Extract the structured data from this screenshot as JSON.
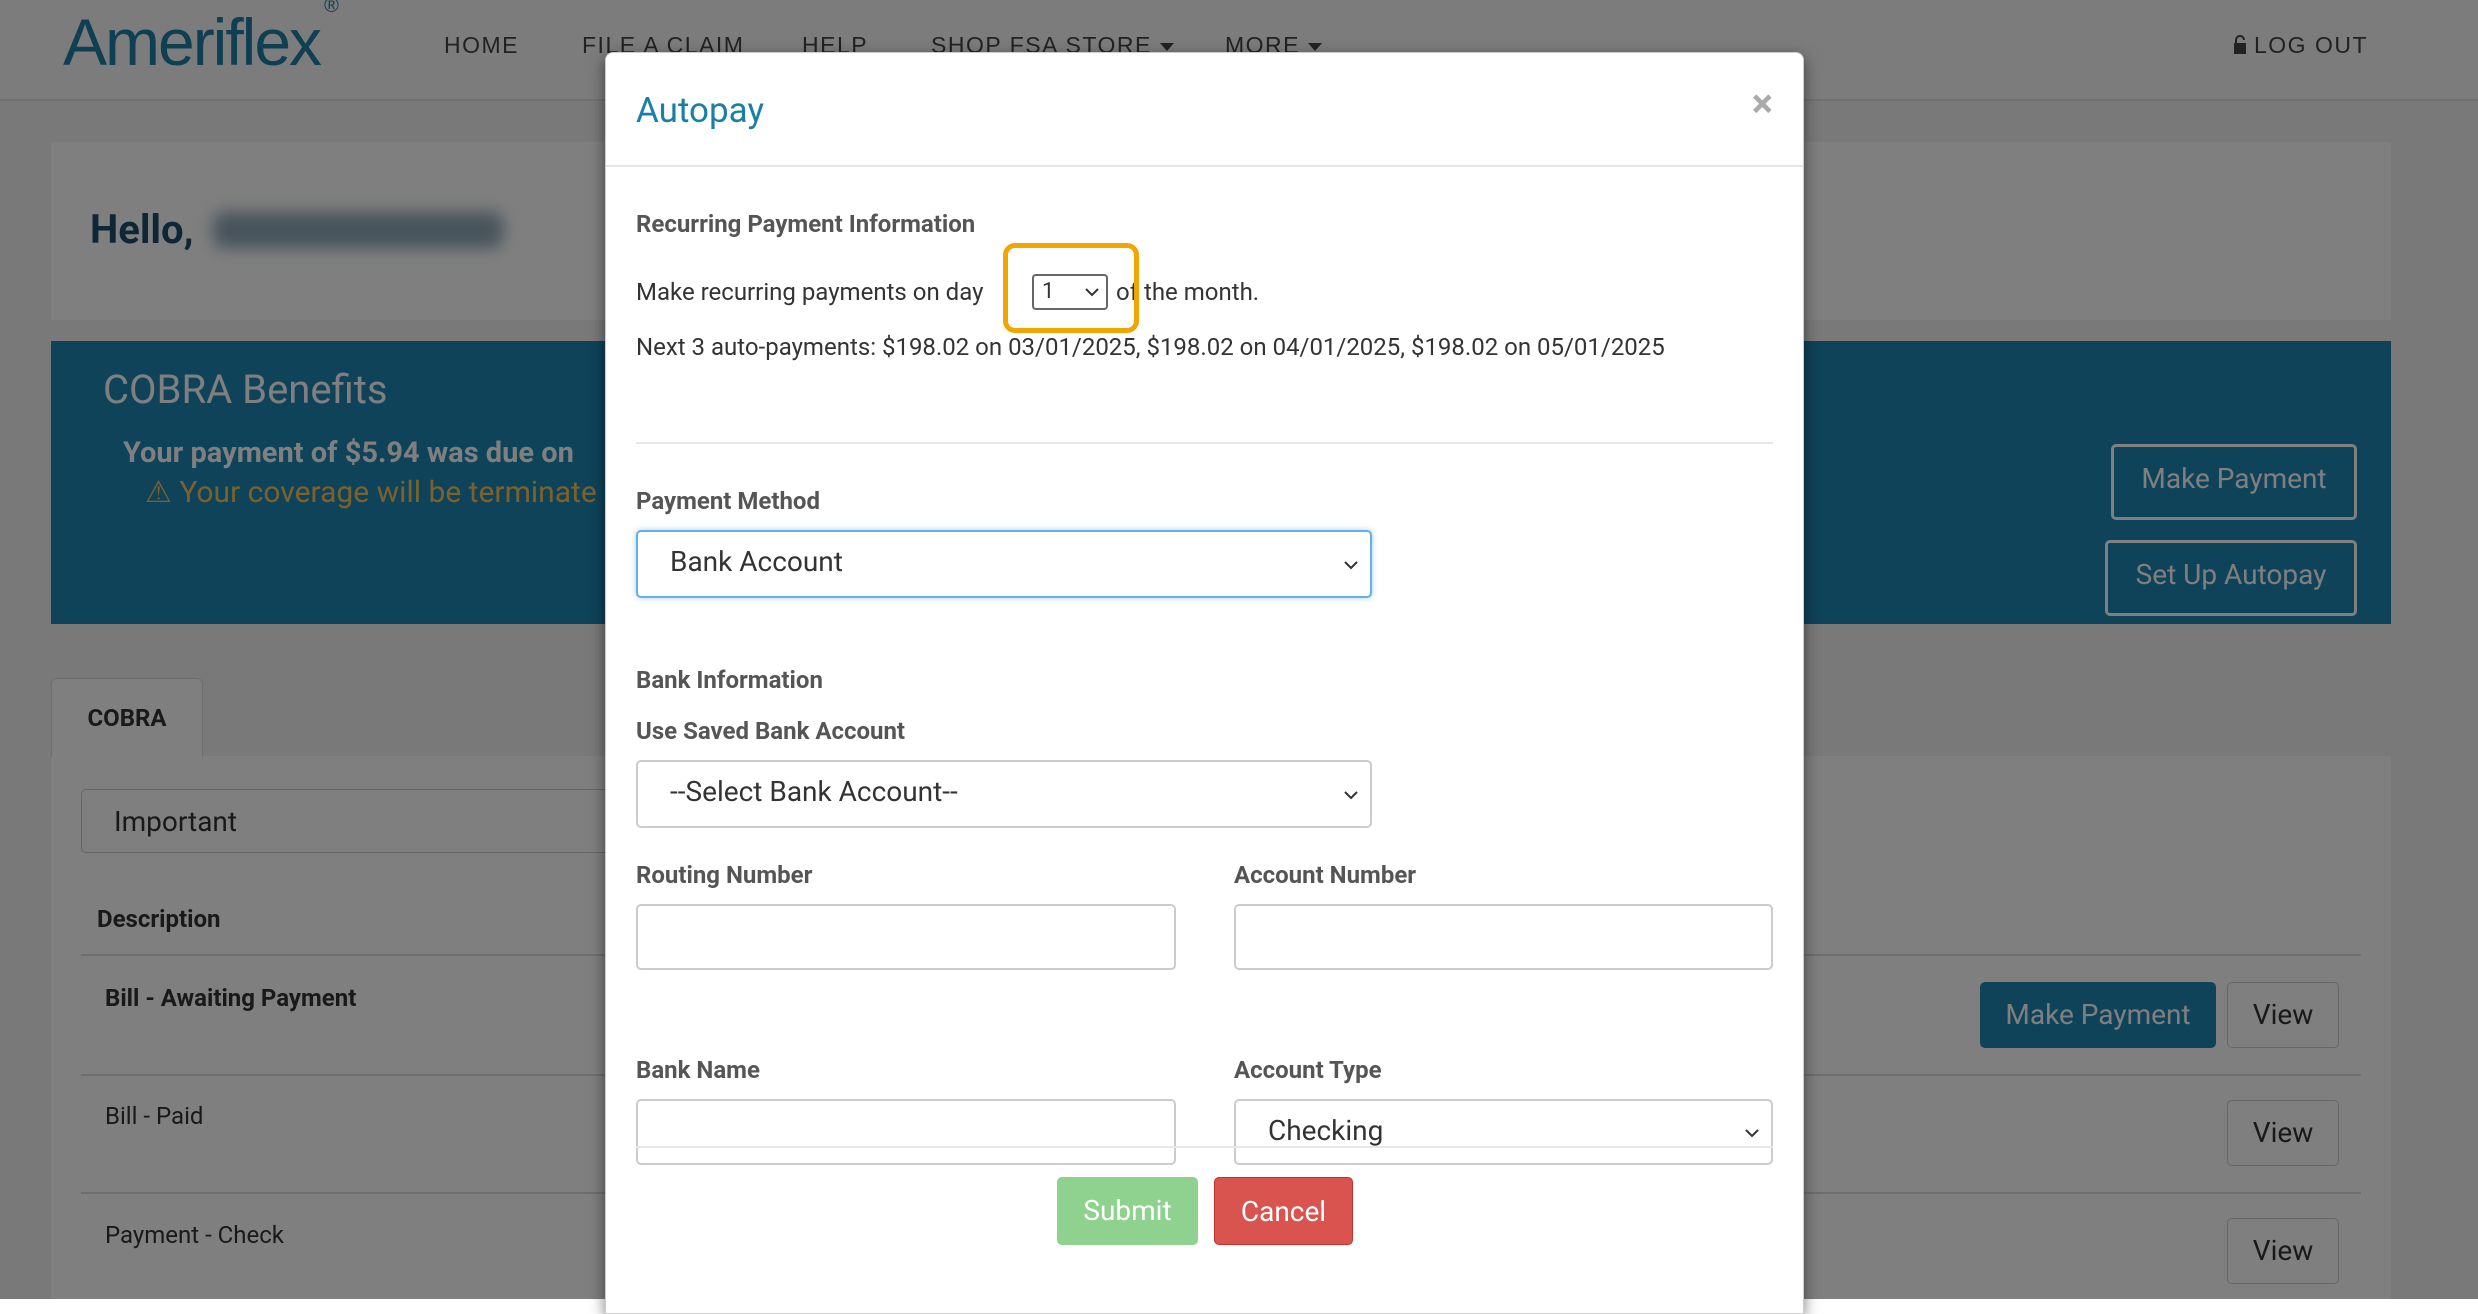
{
  "nav": {
    "logo": "Ameriflex",
    "logo_mark": "®",
    "home": "HOME",
    "file_claim": "FILE A CLAIM",
    "help": "HELP",
    "shop": "SHOP FSA STORE",
    "more": "MORE",
    "logout": "LOG OUT"
  },
  "page": {
    "hello": "Hello,",
    "cobra_title": "COBRA Benefits",
    "payment_due": "Your payment of $5.94 was due on",
    "coverage_warning": "Your coverage will be terminate",
    "make_payment": "Make Payment",
    "setup_autopay": "Set Up Autopay",
    "tab_cobra": "COBRA",
    "filter_value": "Important",
    "col_description": "Description",
    "rows": [
      {
        "desc": "Bill - Awaiting Payment",
        "pay": "Make Payment",
        "view": "View"
      },
      {
        "desc": "Bill - Paid",
        "view": "View"
      },
      {
        "desc": "Payment - Check",
        "view": "View"
      }
    ]
  },
  "modal": {
    "title": "Autopay",
    "close": "×",
    "recurring_heading": "Recurring Payment Information",
    "recurring_prefix": "Make recurring payments on day",
    "recurring_day": "1",
    "recurring_suffix": "of the month.",
    "next_payments": "Next 3 auto-payments: $198.02 on 03/01/2025, $198.02 on 04/01/2025, $198.02 on 05/01/2025",
    "payment_method_label": "Payment Method",
    "payment_method_value": "Bank Account",
    "bank_info_heading": "Bank Information",
    "saved_bank_label": "Use Saved Bank Account",
    "saved_bank_value": "--Select Bank Account--",
    "routing_label": "Routing Number",
    "routing_value": "",
    "account_label": "Account Number",
    "account_value": "",
    "bank_name_label": "Bank Name",
    "bank_name_value": "",
    "account_type_label": "Account Type",
    "account_type_value": "Checking",
    "submit": "Submit",
    "cancel": "Cancel"
  }
}
